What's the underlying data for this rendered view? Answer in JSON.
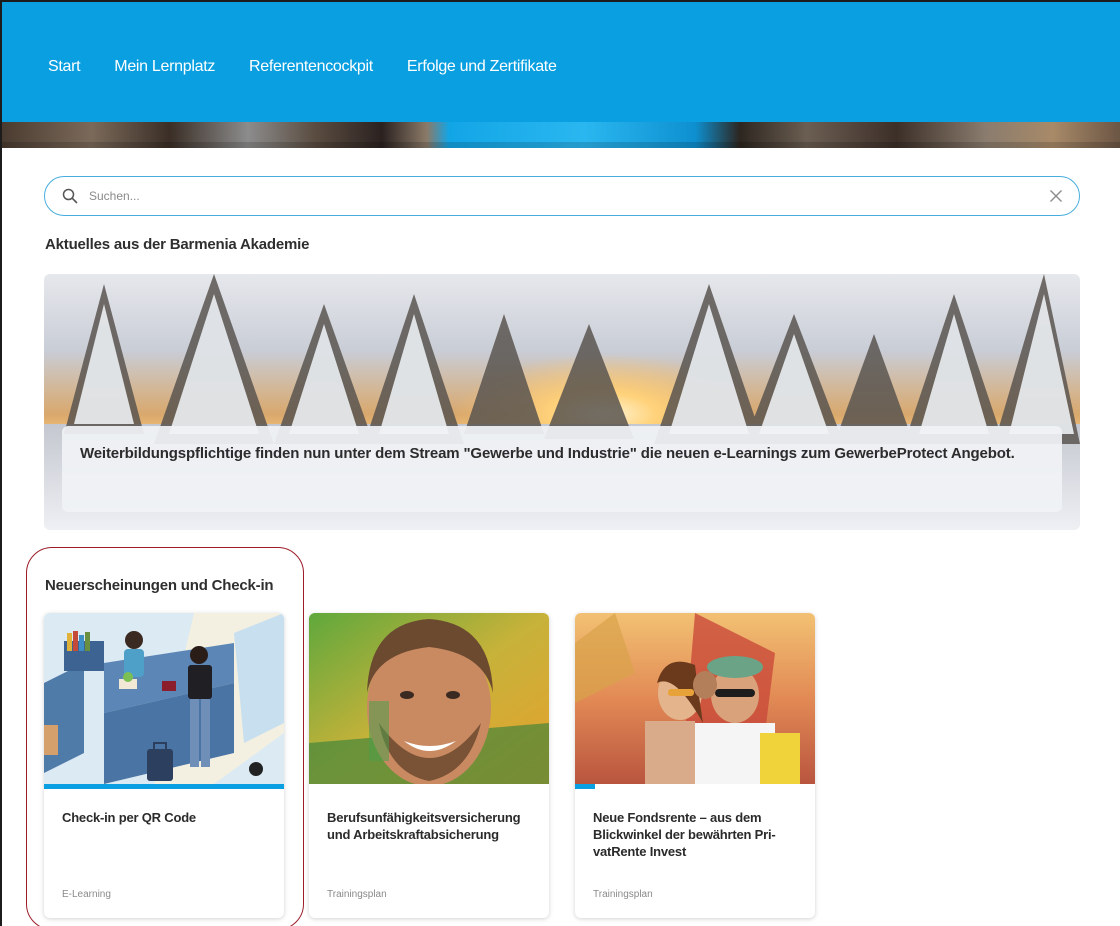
{
  "nav": {
    "items": [
      {
        "label": "Start"
      },
      {
        "label": "Mein Lernplatz"
      },
      {
        "label": "Referentencockpit"
      },
      {
        "label": "Erfolge und Zertifikate"
      }
    ]
  },
  "search": {
    "placeholder": "Suchen...",
    "value": ""
  },
  "news": {
    "heading": "Aktuelles aus der Barmenia Akademie",
    "banner_text": "Weiterbildungspflichtige finden nun unter dem Stream \"Gewerbe und Industrie\" die neuen e-Learnings zum GewerbeProtect Angebot."
  },
  "releases": {
    "heading": "Neuerscheinungen und Check-in",
    "cards": [
      {
        "title": "Check-in per QR Code",
        "type": "E-Learning",
        "progress_percent": 100
      },
      {
        "title": "Berufsunfähigkeitsversicherung und Arbeitskraftabsicherung",
        "type": "Trainingsplan",
        "progress_percent": 0
      },
      {
        "title": "Neue Fondsrente – aus dem Blickwinkel der bewährten Pri-vatRente Invest",
        "type": "Trainingsplan",
        "progress_percent": 8
      }
    ]
  },
  "colors": {
    "accent": "#0a9fe0",
    "highlight": "#9b1c28"
  }
}
